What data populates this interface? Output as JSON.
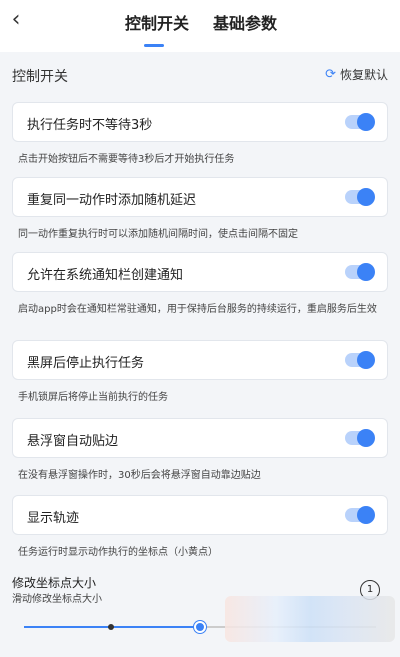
{
  "header": {
    "back_icon": "chevron-left-icon",
    "tabs": [
      {
        "label": "控制开关",
        "active": true
      },
      {
        "label": "基础参数",
        "active": false
      }
    ],
    "accent_color": "#3b82f6"
  },
  "section": {
    "title": "控制开关",
    "restore_label": "恢复默认",
    "restore_icon": "refresh-icon"
  },
  "settings": [
    {
      "label": "执行任务时不等待3秒",
      "enabled": true,
      "description": "点击开始按钮后不需要等待3秒后才开始执行任务"
    },
    {
      "label": "重复同一动作时添加随机延迟",
      "enabled": true,
      "description": "同一动作重复执行时可以添加随机间隔时间，使点击间隔不固定"
    },
    {
      "label": "允许在系统通知栏创建通知",
      "enabled": true,
      "description": "启动app时会在通知栏常驻通知，用于保持后台服务的持续运行，重启服务后生效"
    },
    {
      "label": "黑屏后停止执行任务",
      "enabled": true,
      "description": "手机锁屏后将停止当前执行的任务"
    },
    {
      "label": "悬浮窗自动贴边",
      "enabled": true,
      "description": "在没有悬浮窗操作时，30秒后会将悬浮窗自动靠边贴边"
    },
    {
      "label": "显示轨迹",
      "enabled": true,
      "description": "任务运行时显示动作执行的坐标点（小黄点）"
    }
  ],
  "slider": {
    "title": "修改坐标点大小",
    "description": "滑动修改坐标点大小",
    "value_label": "1",
    "fill_fraction": 0.5
  }
}
